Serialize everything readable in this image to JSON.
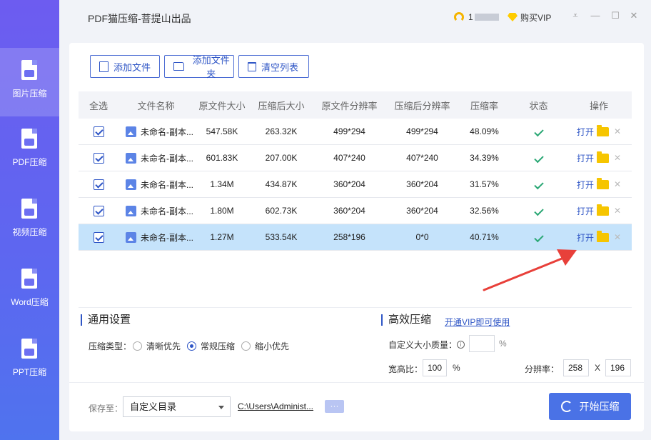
{
  "app": {
    "title": "PDF猫压缩-菩提山出品"
  },
  "titlebar": {
    "user_name": "1",
    "vip_label": "购买VIP"
  },
  "sidebar": {
    "items": [
      {
        "label": "图片压缩",
        "icon": "image-file-icon",
        "active": true
      },
      {
        "label": "PDF压缩",
        "icon": "pdf-file-icon"
      },
      {
        "label": "视频压缩",
        "icon": "video-file-icon"
      },
      {
        "label": "Word压缩",
        "icon": "word-file-icon"
      },
      {
        "label": "PPT压缩",
        "icon": "ppt-file-icon"
      }
    ]
  },
  "toolbar": {
    "add_file": "添加文件",
    "add_folder": "添加文件夹",
    "clear_list": "清空列表"
  },
  "table": {
    "headers": [
      "全选",
      "文件名称",
      "原文件大小",
      "压缩后大小",
      "原文件分辨率",
      "压缩后分辨率",
      "压缩率",
      "状态",
      "操作"
    ],
    "open_label": "打开",
    "rows": [
      {
        "name": "未命名-副本...",
        "orig_size": "547.58K",
        "comp_size": "263.32K",
        "orig_res": "499*294",
        "comp_res": "499*294",
        "rate": "48.09%"
      },
      {
        "name": "未命名-副本...",
        "orig_size": "601.83K",
        "comp_size": "207.00K",
        "orig_res": "407*240",
        "comp_res": "407*240",
        "rate": "34.39%"
      },
      {
        "name": "未命名-副本...",
        "orig_size": "1.34M",
        "comp_size": "434.87K",
        "orig_res": "360*204",
        "comp_res": "360*204",
        "rate": "31.57%"
      },
      {
        "name": "未命名-副本...",
        "orig_size": "1.80M",
        "comp_size": "602.73K",
        "orig_res": "360*204",
        "comp_res": "360*204",
        "rate": "32.56%"
      },
      {
        "name": "未命名-副本...",
        "orig_size": "1.27M",
        "comp_size": "533.54K",
        "orig_res": "258*196",
        "comp_res": "0*0",
        "rate": "40.71%"
      }
    ]
  },
  "settings": {
    "general_title": "通用设置",
    "type_label": "压缩类型：",
    "options": [
      "清晰优先",
      "常规压缩",
      "缩小优先"
    ],
    "selected_option": "常规压缩",
    "efficient_title": "高效压缩",
    "vip_link": "开通VIP即可使用",
    "custom_quality_label": "自定义大小质量：",
    "info_icon_text": "i",
    "quality_value": "",
    "percent_sign": "%",
    "ratio_label": "宽高比：",
    "ratio_value": "100",
    "resolution_label": "分辨率：",
    "res_width": "258",
    "res_x": "X",
    "res_height": "196"
  },
  "footer": {
    "save_label": "保存至：",
    "save_option": "自定义目录",
    "path": "C:\\Users\\Administ...",
    "more": "···",
    "start_button": "开始压缩"
  },
  "colors": {
    "accent": "#4a72e6",
    "sidebar": "#6d5cf0",
    "selected_row": "#c5e3fb",
    "success": "#2aa774"
  }
}
